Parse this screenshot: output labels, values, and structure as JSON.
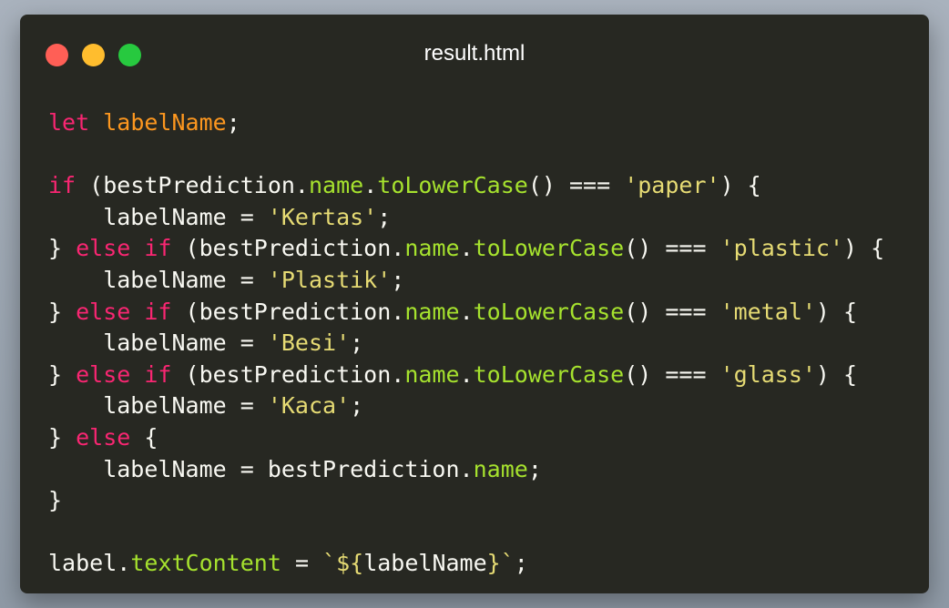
{
  "window": {
    "title": "result.html",
    "colors": {
      "background": "#272822",
      "close": "#ff5f56",
      "minimize": "#ffbd2e",
      "maximize": "#27c93f"
    }
  },
  "code": {
    "lines": [
      [
        {
          "t": "let",
          "c": "keyword"
        },
        {
          "t": " ",
          "c": "plain"
        },
        {
          "t": "labelName",
          "c": "var"
        },
        {
          "t": ";",
          "c": "plain"
        }
      ],
      [],
      [
        {
          "t": "if",
          "c": "keyword"
        },
        {
          "t": " (bestPrediction.",
          "c": "plain"
        },
        {
          "t": "name",
          "c": "prop"
        },
        {
          "t": ".",
          "c": "plain"
        },
        {
          "t": "toLowerCase",
          "c": "prop"
        },
        {
          "t": "() === ",
          "c": "plain"
        },
        {
          "t": "'paper'",
          "c": "string"
        },
        {
          "t": ") {",
          "c": "plain"
        }
      ],
      [
        {
          "t": "    labelName = ",
          "c": "plain"
        },
        {
          "t": "'Kertas'",
          "c": "string"
        },
        {
          "t": ";",
          "c": "plain"
        }
      ],
      [
        {
          "t": "} ",
          "c": "plain"
        },
        {
          "t": "else if",
          "c": "keyword"
        },
        {
          "t": " (bestPrediction.",
          "c": "plain"
        },
        {
          "t": "name",
          "c": "prop"
        },
        {
          "t": ".",
          "c": "plain"
        },
        {
          "t": "toLowerCase",
          "c": "prop"
        },
        {
          "t": "() === ",
          "c": "plain"
        },
        {
          "t": "'plastic'",
          "c": "string"
        },
        {
          "t": ") {",
          "c": "plain"
        }
      ],
      [
        {
          "t": "    labelName = ",
          "c": "plain"
        },
        {
          "t": "'Plastik'",
          "c": "string"
        },
        {
          "t": ";",
          "c": "plain"
        }
      ],
      [
        {
          "t": "} ",
          "c": "plain"
        },
        {
          "t": "else if",
          "c": "keyword"
        },
        {
          "t": " (bestPrediction.",
          "c": "plain"
        },
        {
          "t": "name",
          "c": "prop"
        },
        {
          "t": ".",
          "c": "plain"
        },
        {
          "t": "toLowerCase",
          "c": "prop"
        },
        {
          "t": "() === ",
          "c": "plain"
        },
        {
          "t": "'metal'",
          "c": "string"
        },
        {
          "t": ") {",
          "c": "plain"
        }
      ],
      [
        {
          "t": "    labelName = ",
          "c": "plain"
        },
        {
          "t": "'Besi'",
          "c": "string"
        },
        {
          "t": ";",
          "c": "plain"
        }
      ],
      [
        {
          "t": "} ",
          "c": "plain"
        },
        {
          "t": "else if",
          "c": "keyword"
        },
        {
          "t": " (bestPrediction.",
          "c": "plain"
        },
        {
          "t": "name",
          "c": "prop"
        },
        {
          "t": ".",
          "c": "plain"
        },
        {
          "t": "toLowerCase",
          "c": "prop"
        },
        {
          "t": "() === ",
          "c": "plain"
        },
        {
          "t": "'glass'",
          "c": "string"
        },
        {
          "t": ") {",
          "c": "plain"
        }
      ],
      [
        {
          "t": "    labelName = ",
          "c": "plain"
        },
        {
          "t": "'Kaca'",
          "c": "string"
        },
        {
          "t": ";",
          "c": "plain"
        }
      ],
      [
        {
          "t": "} ",
          "c": "plain"
        },
        {
          "t": "else",
          "c": "keyword"
        },
        {
          "t": " {",
          "c": "plain"
        }
      ],
      [
        {
          "t": "    labelName = bestPrediction.",
          "c": "plain"
        },
        {
          "t": "name",
          "c": "prop"
        },
        {
          "t": ";",
          "c": "plain"
        }
      ],
      [
        {
          "t": "}",
          "c": "plain"
        }
      ],
      [],
      [
        {
          "t": "label.",
          "c": "plain"
        },
        {
          "t": "textContent",
          "c": "prop"
        },
        {
          "t": " = ",
          "c": "plain"
        },
        {
          "t": "`${",
          "c": "string"
        },
        {
          "t": "labelName",
          "c": "plain"
        },
        {
          "t": "}`",
          "c": "string"
        },
        {
          "t": ";",
          "c": "plain"
        }
      ]
    ]
  }
}
